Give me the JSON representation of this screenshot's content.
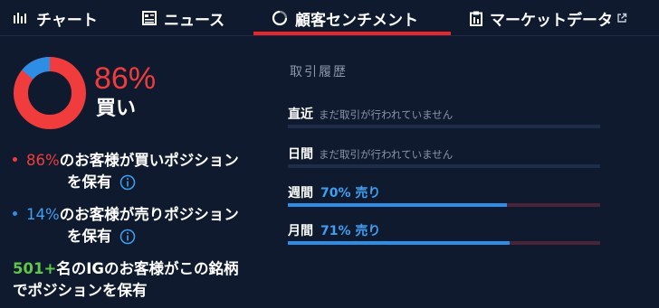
{
  "tabs": [
    {
      "label": "チャート",
      "icon": "chart-bars-icon"
    },
    {
      "label": "ニュース",
      "icon": "news-icon"
    },
    {
      "label": "顧客センチメント",
      "icon": "sentiment-icon",
      "active": true
    },
    {
      "label": "マーケットデータ",
      "icon": "clipboard-icon"
    }
  ],
  "sentiment": {
    "buy_percent": 86,
    "sell_percent": 14,
    "big_pct": "86%",
    "big_label": "買い",
    "buy_pct_text": "86%",
    "buy_text": "のお客様が買いポジション",
    "buy_text2": "を保有",
    "sell_pct_text": "14%",
    "sell_text": "のお客様が売りポジション",
    "sell_text2": "を保有",
    "clients_count": "501+",
    "clients_text": "名のIGのお客様がこの銘柄",
    "clients_text2": "でポジションを保有"
  },
  "history": {
    "title": "取引履歴",
    "rows": [
      {
        "label": "直近",
        "note": "まだ取引が行われていません",
        "value": "",
        "fill": 0
      },
      {
        "label": "日間",
        "note": "まだ取引が行われていません",
        "value": "",
        "fill": 0
      },
      {
        "label": "週間",
        "note": "",
        "value": "70% 売り",
        "fill": 0.7
      },
      {
        "label": "月間",
        "note": "",
        "value": "71% 売り",
        "fill": 0.71
      }
    ]
  },
  "colors": {
    "background": "#0f1a2e",
    "buy": "#f03c3c",
    "sell": "#2e8ee6",
    "accent_tab": "#e8262c",
    "green": "#5ec84b"
  }
}
